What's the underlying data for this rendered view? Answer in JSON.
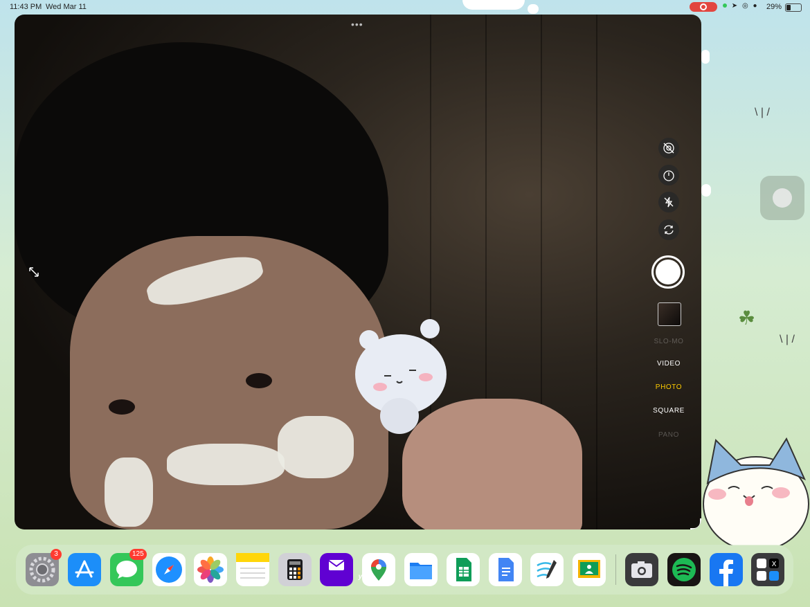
{
  "status_bar": {
    "time": "11:43 PM",
    "date": "Wed Mar 11",
    "battery": "29%",
    "battery_level": 0.29,
    "icons": [
      "screen-recording-icon",
      "location-icon",
      "orientation-lock-icon",
      "alarm-icon",
      "person-icon",
      "battery-icon"
    ]
  },
  "camera": {
    "controls": [
      "live-photo-off-icon",
      "timer-icon",
      "flash-off-icon",
      "flip-camera-icon"
    ],
    "modes": {
      "slomo": "SLO-MO",
      "video": "VIDEO",
      "photo": "PHOTO",
      "square": "SQUARE",
      "pano": "PANO"
    },
    "active_mode": "PHOTO",
    "accent": "#ffcc00"
  },
  "dock": {
    "apps": [
      {
        "name": "Settings",
        "badge": "3",
        "color": "#8e8e93"
      },
      {
        "name": "App Store",
        "color": "#1c8ef9"
      },
      {
        "name": "Messages",
        "badge": "125",
        "color": "#34c759"
      },
      {
        "name": "Safari",
        "color": "#1e90ff"
      },
      {
        "name": "Photos",
        "color": "#ffffff"
      },
      {
        "name": "Notes",
        "color": "#ffd60a"
      },
      {
        "name": "Calculator",
        "color": "#d1d1d6"
      },
      {
        "name": "Yahoo Mail",
        "label": "yahoo!",
        "color": "#6001d2"
      },
      {
        "name": "Google Maps",
        "color": "#ffffff"
      },
      {
        "name": "Files",
        "color": "#1c7df2"
      },
      {
        "name": "Google Sheets",
        "color": "#0f9d58"
      },
      {
        "name": "Google Docs",
        "color": "#4285f4"
      },
      {
        "name": "Freeform",
        "color": "#ffffff"
      },
      {
        "name": "Google Classroom",
        "color": "#f4b400"
      },
      {
        "name": "Camera",
        "color": "#3a3a3c"
      },
      {
        "name": "Spotify",
        "color": "#191414"
      },
      {
        "name": "Facebook",
        "color": "#1877f2"
      },
      {
        "name": "App Library",
        "color": "#3a3a3c"
      }
    ]
  }
}
